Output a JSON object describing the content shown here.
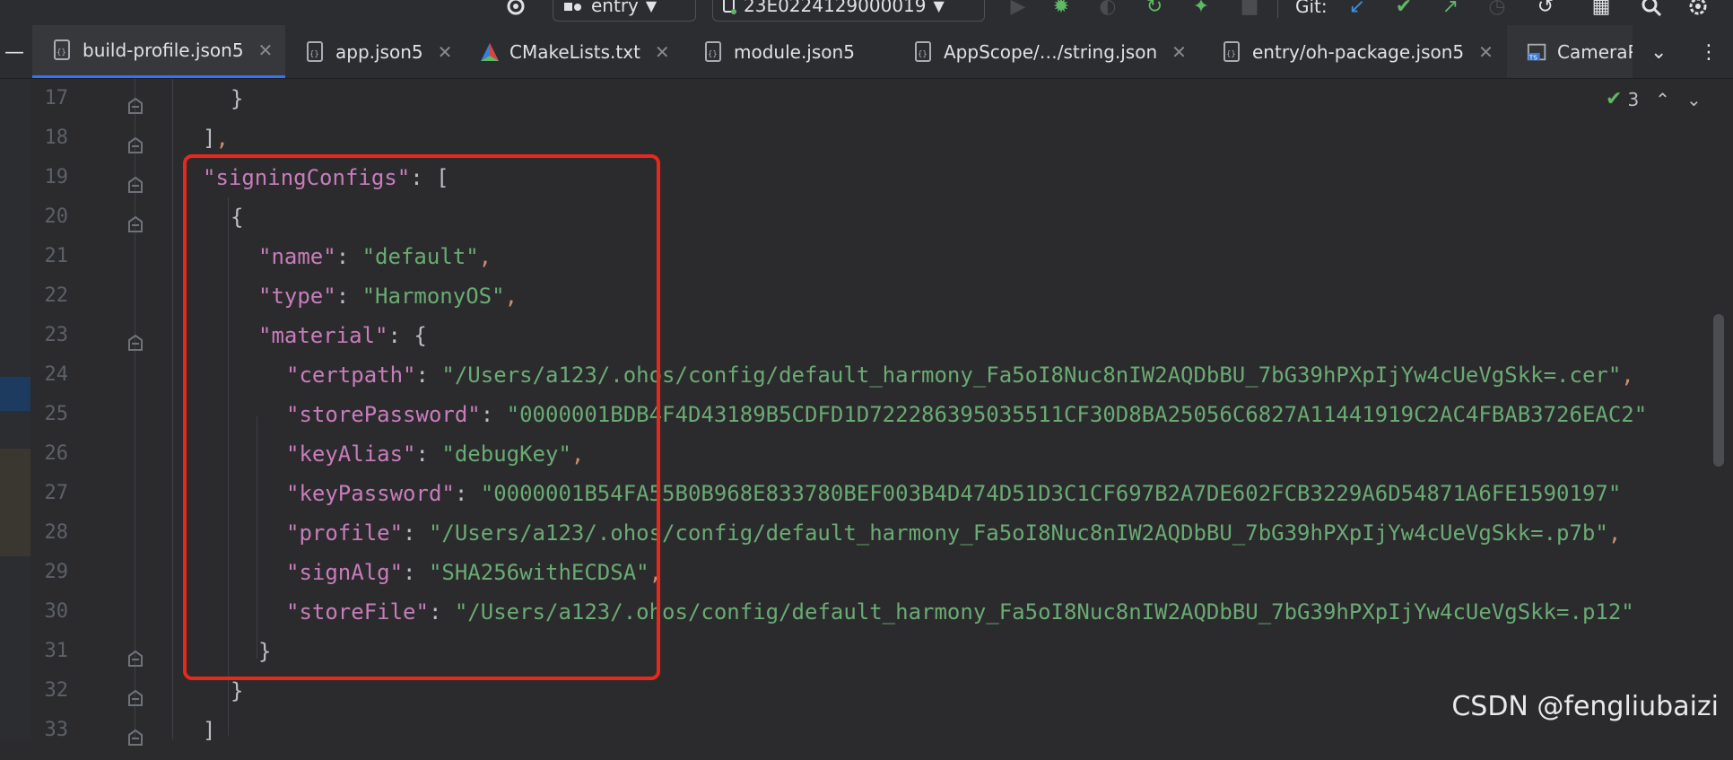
{
  "toolbar": {
    "run_config": "entry",
    "device": "23E0224129000019",
    "git_label": "Git:"
  },
  "tabs": [
    {
      "label": "build-profile.json5",
      "active": true,
      "icon": "json-file-icon"
    },
    {
      "label": "app.json5",
      "active": false,
      "icon": "json-file-icon"
    },
    {
      "label": "CMakeLists.txt",
      "active": false,
      "icon": "cmake-icon"
    },
    {
      "label": "module.json5",
      "active": false,
      "icon": "json-file-icon"
    },
    {
      "label": "AppScope/…/string.json",
      "active": false,
      "icon": "json-file-icon"
    },
    {
      "label": "entry/oh-package.json5",
      "active": false,
      "icon": "json-file-icon"
    },
    {
      "label": "CameraP",
      "active": false,
      "icon": "ts-file-icon"
    }
  ],
  "inspection": {
    "count": "3"
  },
  "editor": {
    "lines": [
      {
        "n": "17",
        "indent": 1,
        "parts": [
          {
            "t": "}",
            "c": "p"
          }
        ]
      },
      {
        "n": "18",
        "indent": 0,
        "parts": [
          {
            "t": "]",
            "c": "p"
          },
          {
            "t": ",",
            "c": "c"
          }
        ]
      },
      {
        "n": "19",
        "indent": 0,
        "parts": [
          {
            "t": "\"signingConfigs\"",
            "c": "k"
          },
          {
            "t": ": [",
            "c": "p"
          }
        ]
      },
      {
        "n": "20",
        "indent": 1,
        "parts": [
          {
            "t": "{",
            "c": "p"
          }
        ]
      },
      {
        "n": "21",
        "indent": 2,
        "parts": [
          {
            "t": "\"name\"",
            "c": "k"
          },
          {
            "t": ": ",
            "c": "p"
          },
          {
            "t": "\"default\"",
            "c": "s"
          },
          {
            "t": ",",
            "c": "c"
          }
        ]
      },
      {
        "n": "22",
        "indent": 2,
        "parts": [
          {
            "t": "\"type\"",
            "c": "k"
          },
          {
            "t": ": ",
            "c": "p"
          },
          {
            "t": "\"HarmonyOS\"",
            "c": "s"
          },
          {
            "t": ",",
            "c": "c"
          }
        ]
      },
      {
        "n": "23",
        "indent": 2,
        "parts": [
          {
            "t": "\"material\"",
            "c": "k"
          },
          {
            "t": ": {",
            "c": "p"
          }
        ]
      },
      {
        "n": "24",
        "indent": 3,
        "parts": [
          {
            "t": "\"certpath\"",
            "c": "k"
          },
          {
            "t": ": ",
            "c": "p"
          },
          {
            "t": "\"/Users/a123/.ohos/config/default_harmony_Fa5oI8Nuc8nIW2AQDbBU_7bG39hPXpIjYw4cUeVgSkk=.cer\"",
            "c": "s"
          },
          {
            "t": ",",
            "c": "c"
          }
        ]
      },
      {
        "n": "25",
        "indent": 3,
        "parts": [
          {
            "t": "\"storePassword\"",
            "c": "k"
          },
          {
            "t": ": ",
            "c": "p"
          },
          {
            "t": "\"0000001BDB4F4D43189B5CDFD1D722286395035511CF30D8BA25056C6827A11441919C2AC4FBAB3726EAC2\"",
            "c": "s"
          }
        ]
      },
      {
        "n": "26",
        "indent": 3,
        "parts": [
          {
            "t": "\"keyAlias\"",
            "c": "k"
          },
          {
            "t": ": ",
            "c": "p"
          },
          {
            "t": "\"debugKey\"",
            "c": "s"
          },
          {
            "t": ",",
            "c": "c"
          }
        ]
      },
      {
        "n": "27",
        "indent": 3,
        "parts": [
          {
            "t": "\"keyPassword\"",
            "c": "k"
          },
          {
            "t": ": ",
            "c": "p"
          },
          {
            "t": "\"0000001B54FA55B0B968E833780BEF003B4D474D51D3C1CF697B2A7DE602FCB3229A6D54871A6FE1590197\"",
            "c": "s"
          }
        ]
      },
      {
        "n": "28",
        "indent": 3,
        "parts": [
          {
            "t": "\"profile\"",
            "c": "k"
          },
          {
            "t": ": ",
            "c": "p"
          },
          {
            "t": "\"/Users/a123/.ohos/config/default_harmony_Fa5oI8Nuc8nIW2AQDbBU_7bG39hPXpIjYw4cUeVgSkk=.p7b\"",
            "c": "s"
          },
          {
            "t": ",",
            "c": "c"
          }
        ]
      },
      {
        "n": "29",
        "indent": 3,
        "parts": [
          {
            "t": "\"signAlg\"",
            "c": "k"
          },
          {
            "t": ": ",
            "c": "p"
          },
          {
            "t": "\"SHA256withECDSA\"",
            "c": "s"
          },
          {
            "t": ",",
            "c": "c"
          }
        ]
      },
      {
        "n": "30",
        "indent": 3,
        "parts": [
          {
            "t": "\"storeFile\"",
            "c": "k"
          },
          {
            "t": ": ",
            "c": "p"
          },
          {
            "t": "\"/Users/a123/.ohos/config/default_harmony_Fa5oI8Nuc8nIW2AQDbBU_7bG39hPXpIjYw4cUeVgSkk=.p12\"",
            "c": "s"
          }
        ]
      },
      {
        "n": "31",
        "indent": 2,
        "parts": [
          {
            "t": "}",
            "c": "p"
          }
        ]
      },
      {
        "n": "32",
        "indent": 1,
        "parts": [
          {
            "t": "}",
            "c": "p"
          }
        ]
      },
      {
        "n": "33",
        "indent": 0,
        "parts": [
          {
            "t": "]",
            "c": "p"
          }
        ]
      }
    ]
  },
  "watermark": "CSDN @fengliubaizi",
  "colors": {
    "accent": "#3574f0",
    "highlight": "#e8281d",
    "key": "#c77dbb",
    "string": "#6aab73"
  }
}
